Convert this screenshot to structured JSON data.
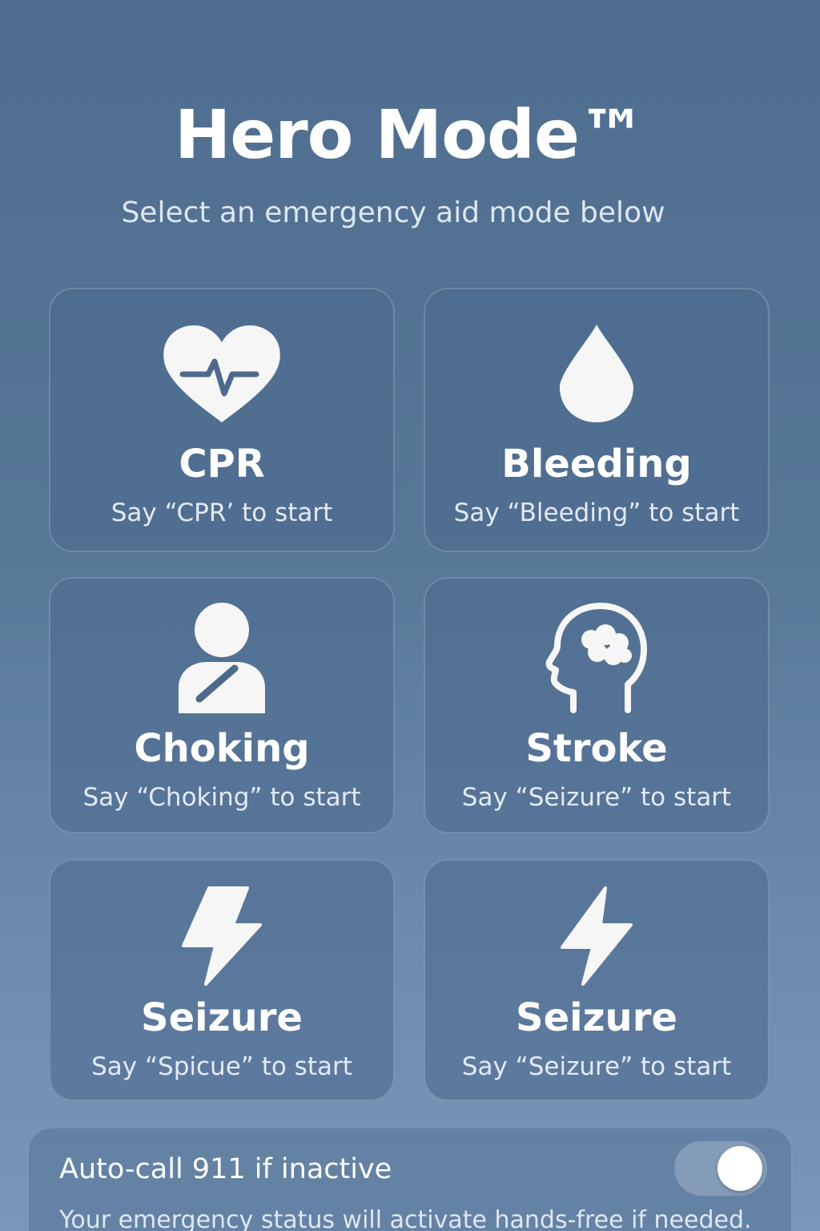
{
  "header": {
    "title": "Hero Mode™",
    "subtitle": "Select an emergency aid mode below"
  },
  "modes": [
    {
      "name": "CPR",
      "hint": "Say “CPR’ to start",
      "icon": "heart-pulse-icon"
    },
    {
      "name": "Bleeding",
      "hint": "Say “Bleeding” to start",
      "icon": "drop-icon"
    },
    {
      "name": "Choking",
      "hint": "Say “Choking” to start",
      "icon": "person-sling-icon"
    },
    {
      "name": "Stroke",
      "hint": "Say “Seizure” to start",
      "icon": "head-brain-icon"
    },
    {
      "name": "Seizure",
      "hint": "Say “Spicue” to start",
      "icon": "lightning-bolt-icon"
    },
    {
      "name": "Seizure",
      "hint": "Say “Seizure” to start",
      "icon": "lightning-bolt-icon"
    }
  ],
  "settings": {
    "auto_call_label": "Auto-call 911 if inactive",
    "auto_call_enabled": true,
    "auto_call_description": "Your emergency status will activate hands-free if needed."
  },
  "colors": {
    "background_top": "#4f6d8f",
    "background_bottom": "#7a97b9",
    "card": "#4a688c",
    "text": "#ffffff",
    "icon": "#f6f6f6"
  }
}
